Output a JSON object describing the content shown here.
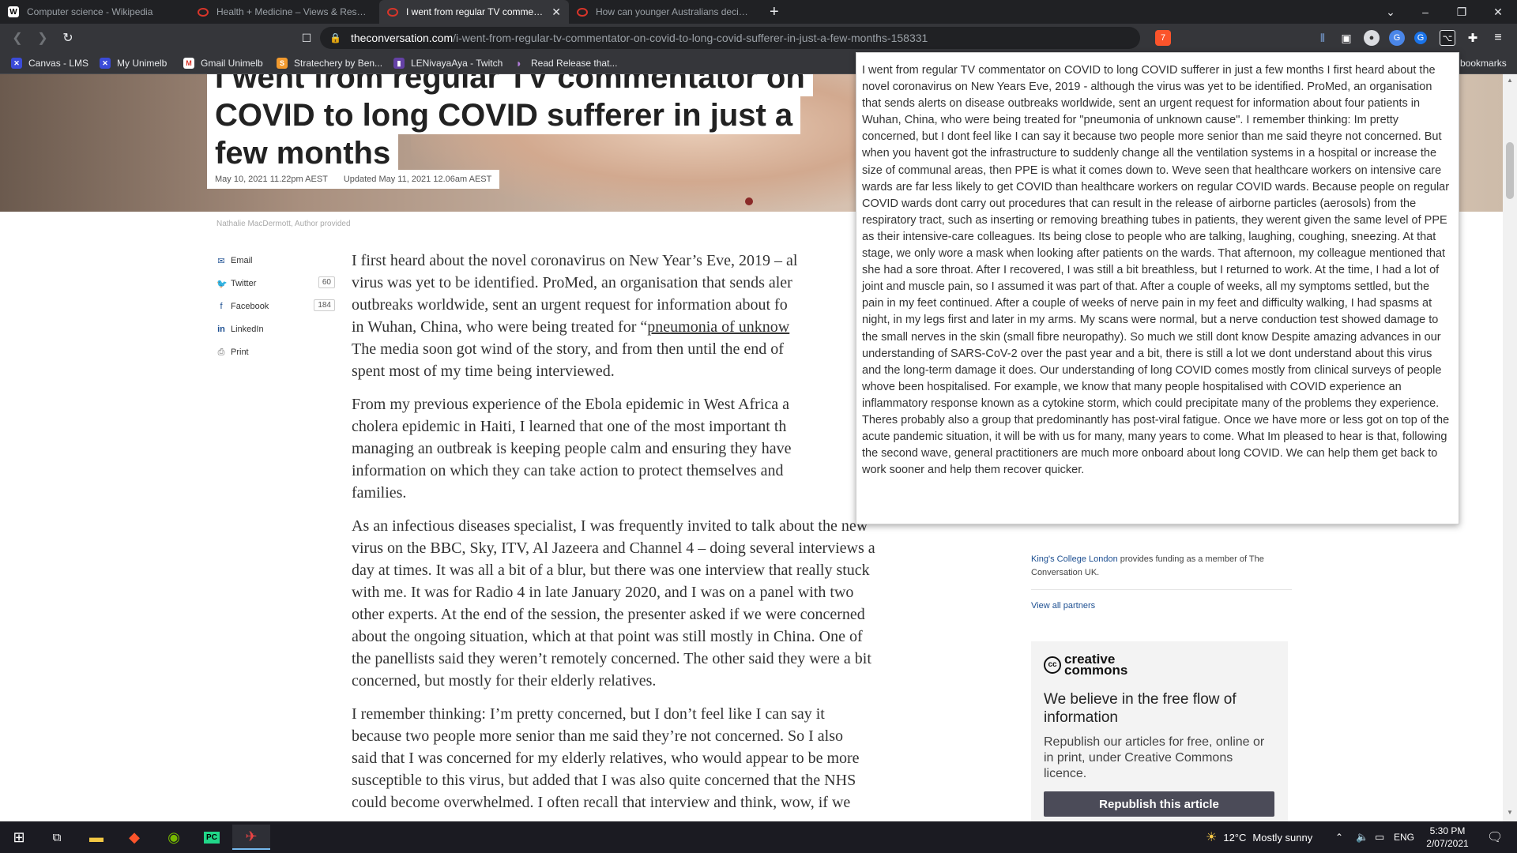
{
  "browser": {
    "tabs": [
      {
        "title": "Computer science - Wikipedia",
        "icon": "wikipedia-icon",
        "active": false
      },
      {
        "title": "Health + Medicine – Views & Research",
        "icon": "conversation-icon",
        "active": false
      },
      {
        "title": "I went from regular TV commentator on COVID",
        "icon": "conversation-icon",
        "active": true
      },
      {
        "title": "How can younger Australians decide a",
        "icon": "conversation-icon",
        "active": false
      }
    ],
    "new_tab": "+",
    "url_host": "theconversation.com",
    "url_path": "/i-went-from-regular-tv-commentator-on-covid-to-long-covid-sufferer-in-just-a-few-months-158331",
    "brave_badge": "7",
    "bookmarks": [
      {
        "label": "Canvas - LMS",
        "icon": "canvas-icon",
        "color": "#3b4bd8"
      },
      {
        "label": "My Unimelb",
        "icon": "unimelb-icon",
        "color": "#3b4bd8"
      },
      {
        "label": "Gmail Unimelb",
        "icon": "gmail-icon",
        "color": "#d93025"
      },
      {
        "label": "Stratechery by Ben...",
        "icon": "stratechery-icon",
        "color": "#f29a2e"
      },
      {
        "label": "LENivayaAya - Twitch",
        "icon": "twitch-icon",
        "color": "#6441a5"
      },
      {
        "label": "Read Release that...",
        "icon": "bookmark-icon",
        "color": "#8e44ad"
      }
    ],
    "other_bookmarks": "bookmarks"
  },
  "article": {
    "title_lines": [
      "I went from regular TV commentator on",
      "COVID to long COVID sufferer in just a",
      "few months"
    ],
    "published": "May 10, 2021 11.22pm AEST",
    "updated": "Updated May 11, 2021 12.06am AEST",
    "image_caption": "Nathalie MacDermott, Author provided",
    "share": [
      {
        "label": "Email",
        "icon": "email-icon",
        "count": null
      },
      {
        "label": "Twitter",
        "icon": "twitter-icon",
        "count": "60"
      },
      {
        "label": "Facebook",
        "icon": "facebook-icon",
        "count": "184"
      },
      {
        "label": "LinkedIn",
        "icon": "linkedin-icon",
        "count": null
      },
      {
        "label": "Print",
        "icon": "print-icon",
        "count": null
      }
    ],
    "p1_a": "I first heard about the novel coronavirus on New Year’s Eve, 2019 – al",
    "p1_b": "virus was yet to be identified. ProMed, an organisation that sends aler",
    "p1_c": "outbreaks worldwide, sent an urgent request for information about fo",
    "p1_d": "in Wuhan, China, who were being treated for “",
    "p1_link": "pneumonia of unknow",
    "p1_e": "The media soon got wind of the story, and from then until the end of",
    "p1_f": "spent most of my time being interviewed.",
    "p2": [
      "From my previous experience of the Ebola epidemic in West Africa a",
      "cholera epidemic in Haiti, I learned that one of the most important th",
      "managing an outbreak is keeping people calm and ensuring they have",
      "information on which they can take action to protect themselves and",
      "families."
    ],
    "p3": [
      "As an infectious diseases specialist, I was frequently invited to talk about the new",
      "virus on the BBC, Sky, ITV, Al Jazeera and Channel 4 – doing several interviews a",
      "day at times. It was all a bit of a blur, but there was one interview that really stuck",
      "with me. It was for Radio 4 in late January 2020, and I was on a panel with two",
      "other experts. At the end of the session, the presenter asked if we were concerned",
      "about the ongoing situation, which at that point was still mostly in China. One of",
      "the panellists said they weren’t remotely concerned. The other said they were a bit",
      "concerned, but mostly for their elderly relatives."
    ],
    "p4": [
      "I remember thinking: I’m pretty concerned, but I don’t feel like I can say it",
      "because two people more senior than me said they’re not concerned. So I also",
      "said that I was concerned for my elderly relatives, who would appear to be more",
      "susceptible to this virus, but added that I was also quite concerned that the NHS",
      "could become overwhelmed. I often recall that interview and think, wow, if we"
    ]
  },
  "sidebar": {
    "partner_name": "King's College London",
    "partner_text": " provides funding as a member of The Conversation UK.",
    "view_all": "View all partners",
    "cc_logo": "creative commons",
    "cc_heading": "We believe in the free flow of information",
    "cc_body": "Republish our articles for free, online or in print, under Creative Commons licence.",
    "republish_button": "Republish this article"
  },
  "popup": {
    "text": "I went from regular TV commentator on COVID to long COVID sufferer in just a few months I first heard about the novel coronavirus on New Years Eve, 2019 - although the virus was yet to be identified. ProMed, an organisation that sends alerts on disease outbreaks worldwide, sent an urgent request for information about four patients in Wuhan, China, who were being treated for \"pneumonia of unknown cause\". I remember thinking: Im pretty concerned, but I dont feel like I can say it because two people more senior than me said theyre not concerned. But when you havent got the infrastructure to suddenly change all the ventilation systems in a hospital or increase the size of communal areas, then PPE is what it comes down to. Weve seen that healthcare workers on intensive care wards are far less likely to get COVID than healthcare workers on regular COVID wards. Because people on regular COVID wards dont carry out procedures that can result in the release of airborne particles (aerosols) from the respiratory tract, such as inserting or removing breathing tubes in patients, they werent given the same level of PPE as their intensive-care colleagues. Its being close to people who are talking, laughing, coughing, sneezing. At that stage, we only wore a mask when looking after patients on the wards. That afternoon, my colleague mentioned that she had a sore throat. After I recovered, I was still a bit breathless, but I returned to work. At the time, I had a lot of joint and muscle pain, so I assumed it was part of that. After a couple of weeks, all my symptoms settled, but the pain in my feet continued. After a couple of weeks of nerve pain in my feet and difficulty walking, I had spasms at night, in my legs first and later in my arms. My scans were normal, but a nerve conduction test showed damage to the small nerves in the skin (small fibre neuropathy). So much we still dont know Despite amazing advances in our understanding of SARS-CoV-2 over the past year and a bit, there is still a lot we dont understand about this virus and the long-term damage it does. Our understanding of long COVID comes mostly from clinical surveys of people whove been hospitalised. For example, we know that many people hospitalised with COVID experience an inflammatory response known as a cytokine storm, which could precipitate many of the problems they experience. Theres probably also a group that predominantly has post-viral fatigue. Once we have more or less got on top of the acute pandemic situation, it will be with us for many, many years to come. What Im pleased to hear is that, following the second wave, general practitioners are much more onboard about long COVID. We can help them get back to work sooner and help them recover quicker."
  },
  "taskbar": {
    "weather_temp": "12°C",
    "weather_desc": "Mostly sunny",
    "language": "ENG",
    "time": "5:30 PM",
    "date": "2/07/2021",
    "apps": [
      "task-view-icon",
      "file-explorer-icon",
      "brave-icon",
      "nvidia-icon",
      "pycharm-icon",
      "app-icon"
    ]
  }
}
